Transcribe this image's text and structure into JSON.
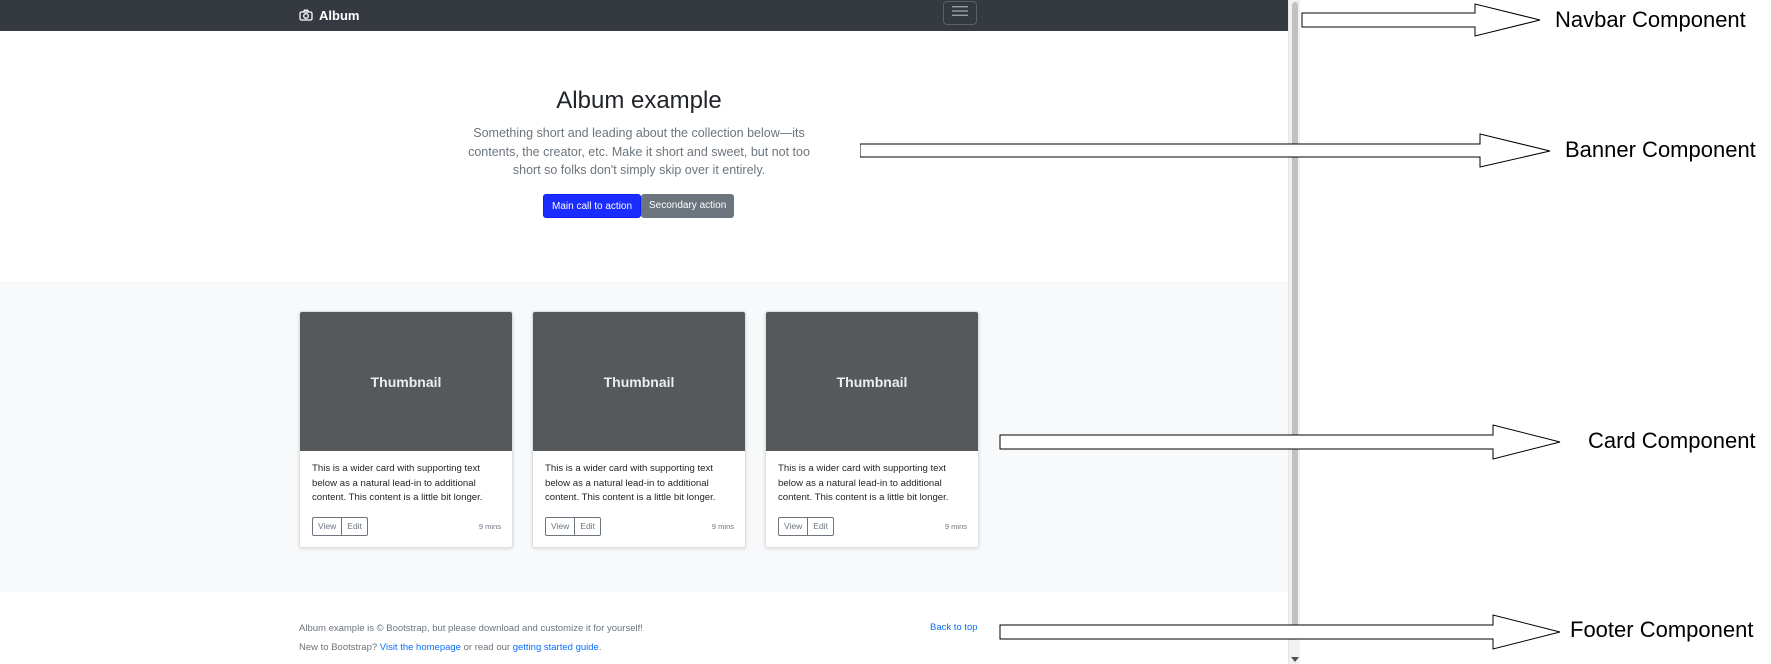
{
  "navbar": {
    "brand": "Album",
    "brand_icon": "camera-icon",
    "toggler_icon": "hamburger-icon"
  },
  "banner": {
    "heading": "Album example",
    "lead": "Something short and leading about the collection below—its contents, the creator, etc. Make it short and sweet, but not too short so folks don't simply skip over it entirely.",
    "primary_button": "Main call to action",
    "secondary_button": "Secondary action",
    "primary_color": "#1a2cff"
  },
  "cards": [
    {
      "thumbnail": "Thumbnail",
      "text": "This is a wider card with supporting text below as a natural lead-in to additional content. This content is a little bit longer.",
      "view": "View",
      "edit": "Edit",
      "time": "9 mins"
    },
    {
      "thumbnail": "Thumbnail",
      "text": "This is a wider card with supporting text below as a natural lead-in to additional content. This content is a little bit longer.",
      "view": "View",
      "edit": "Edit",
      "time": "9 mins"
    },
    {
      "thumbnail": "Thumbnail",
      "text": "This is a wider card with supporting text below as a natural lead-in to additional content. This content is a little bit longer.",
      "view": "View",
      "edit": "Edit",
      "time": "9 mins"
    }
  ],
  "footer": {
    "line1": "Album example is © Bootstrap, but please download and customize it for yourself!",
    "line2_prefix": "New to Bootstrap? ",
    "line2_link1": "Visit the homepage",
    "line2_mid": " or read our ",
    "line2_link2": "getting started guide",
    "line2_suffix": ".",
    "back_to_top": "Back to top"
  },
  "annotations": {
    "navbar": "Navbar Component",
    "banner": "Banner Component",
    "card": "Card Component",
    "footer": "Footer Component"
  }
}
